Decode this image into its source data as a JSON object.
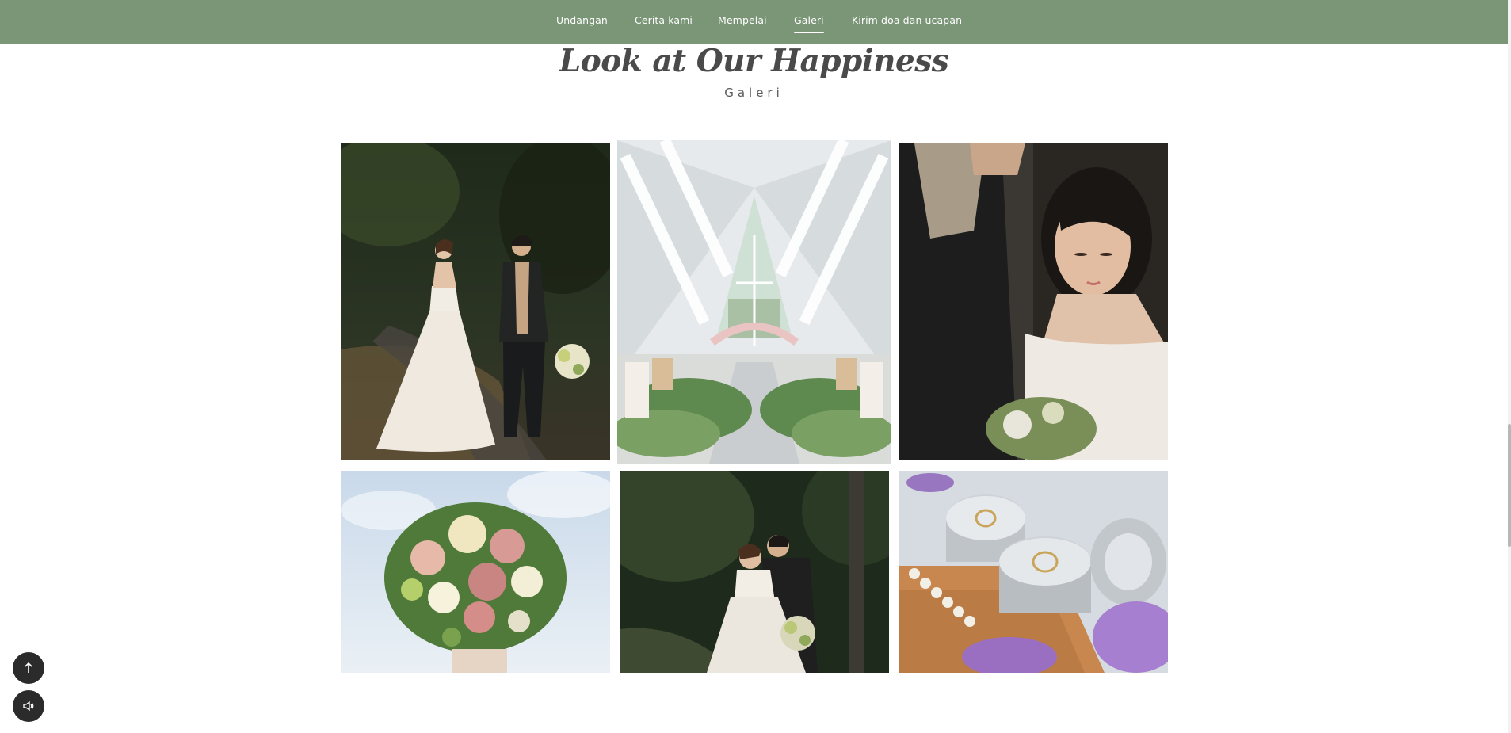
{
  "nav": {
    "items": [
      {
        "label": "Undangan",
        "active": false
      },
      {
        "label": "Cerita kami",
        "active": false
      },
      {
        "label": "Mempelai",
        "active": false
      },
      {
        "label": "Galeri",
        "active": true
      },
      {
        "label": "Kirim doa dan ucapan",
        "active": false
      }
    ]
  },
  "section": {
    "title": "Look at Our Happiness",
    "subtitle": "Galeri"
  },
  "gallery": {
    "photos": [
      {
        "subject": "couple walking on forest path"
      },
      {
        "subject": "glass chapel aisle with flowers"
      },
      {
        "subject": "couple close-up embrace"
      },
      {
        "subject": "bridal bouquet against sky"
      },
      {
        "subject": "couple kissing in forest"
      },
      {
        "subject": "wedding rings in silver boxes"
      }
    ]
  },
  "controls": {
    "scroll_top_icon": "arrow-up-icon",
    "sound_icon": "speaker-icon"
  },
  "colors": {
    "nav_background": "#7a9677",
    "nav_text": "#ffffff",
    "title_text": "#4a4a4a",
    "fab_background": "#2b2b2b"
  }
}
